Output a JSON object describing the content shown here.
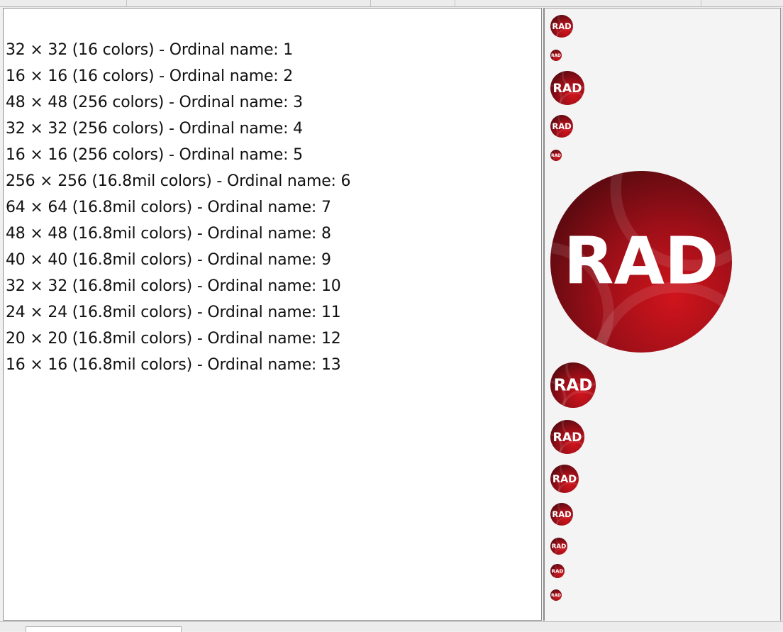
{
  "icon_list": {
    "entries": [
      "32 × 32 (16 colors) - Ordinal name: 1",
      "16 × 16 (16 colors) - Ordinal name: 2",
      "48 × 48 (256 colors) - Ordinal name: 3",
      "32 × 32 (256 colors) - Ordinal name: 4",
      "16 × 16 (256 colors) - Ordinal name: 5",
      "256 × 256 (16.8mil colors) - Ordinal name: 6",
      "64 × 64 (16.8mil colors) - Ordinal name: 7",
      "48 × 48 (16.8mil colors) - Ordinal name: 8",
      "40 × 40 (16.8mil colors) - Ordinal name: 9",
      "32 × 32 (16.8mil colors) - Ordinal name: 10",
      "24 × 24 (16.8mil colors) - Ordinal name: 11",
      "20 × 20 (16.8mil colors) - Ordinal name: 12",
      "16 × 16 (16.8mil colors) - Ordinal name: 13"
    ]
  },
  "preview": {
    "icon_text": "RAD",
    "icon_name": "rad-logo-icon",
    "colors": {
      "dark_red": "#5e0a10",
      "mid_red": "#9c0f18",
      "bright_red": "#d0141c",
      "text": "#ffffff"
    }
  }
}
